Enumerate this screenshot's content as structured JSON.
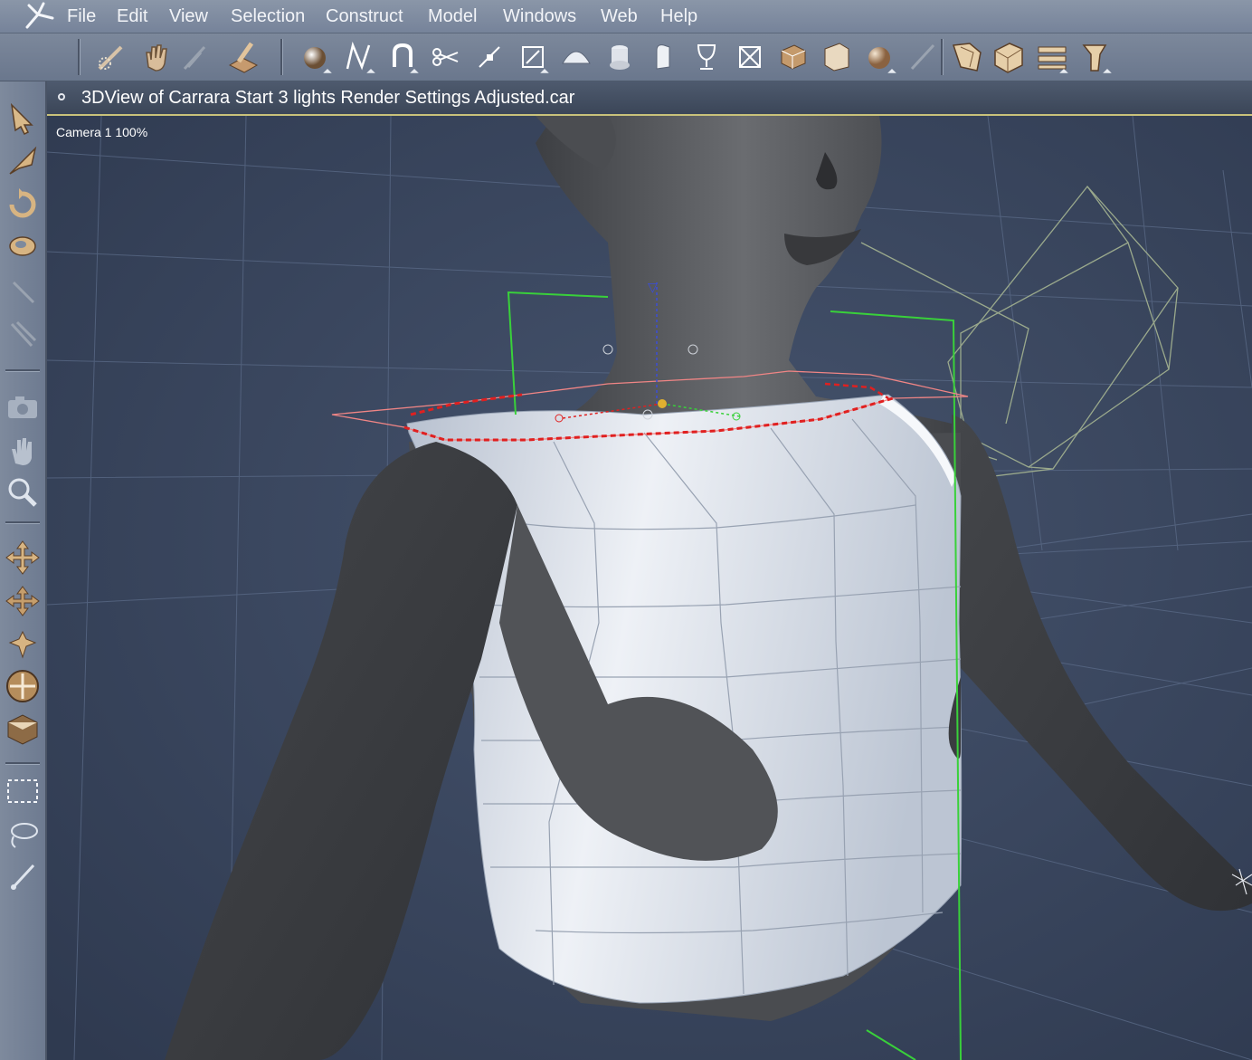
{
  "menubar": {
    "items": [
      "File",
      "Edit",
      "View",
      "Selection",
      "Construct",
      "Model",
      "Windows",
      "Web",
      "Help"
    ]
  },
  "toolbar": {
    "tools": [
      "paint-selection-icon",
      "pan-hand-icon",
      "disabled-hand-icon",
      "shader-brush-icon",
      "sphere-primitive-icon",
      "spline-icon",
      "magnet-icon",
      "scissors-icon",
      "scale-point-icon",
      "bounding-box-icon",
      "half-dome-icon",
      "lathe-icon",
      "extrude-icon",
      "goblet-icon",
      "box-frame-icon",
      "cube-icon",
      "folded-box-icon",
      "shaded-sphere-icon",
      "brush-stroke-icon",
      "room-tab-assemble-icon",
      "room-tab-model-icon",
      "room-tab-storyboard-icon",
      "room-tab-texture-icon"
    ]
  },
  "left_toolbar": {
    "tools": [
      "selection-arrow-icon",
      "move-3d-icon",
      "rotate-icon",
      "scale-ring-icon",
      "wand-icon",
      "link-icon",
      "camera-icon",
      "pan-hand-icon",
      "zoom-magnifier-icon",
      "move-4way-icon",
      "move-plane-icon",
      "move-compass-icon",
      "trackball-icon",
      "render-box-icon",
      "rectangle-select-icon",
      "lasso-select-icon",
      "paint-select-icon"
    ]
  },
  "view_window": {
    "title": "3DView of Carrara Start 3 lights Render Settings Adjusted.car",
    "camera_label": "Camera 1 100%"
  },
  "colors": {
    "menubar": "#8a96a8",
    "viewport_bg": "#36435c",
    "selection_red": "#e02020",
    "bounding_green": "#39d13a",
    "mesh_white": "#e4e8f0",
    "figure_gray": "#55575b"
  }
}
